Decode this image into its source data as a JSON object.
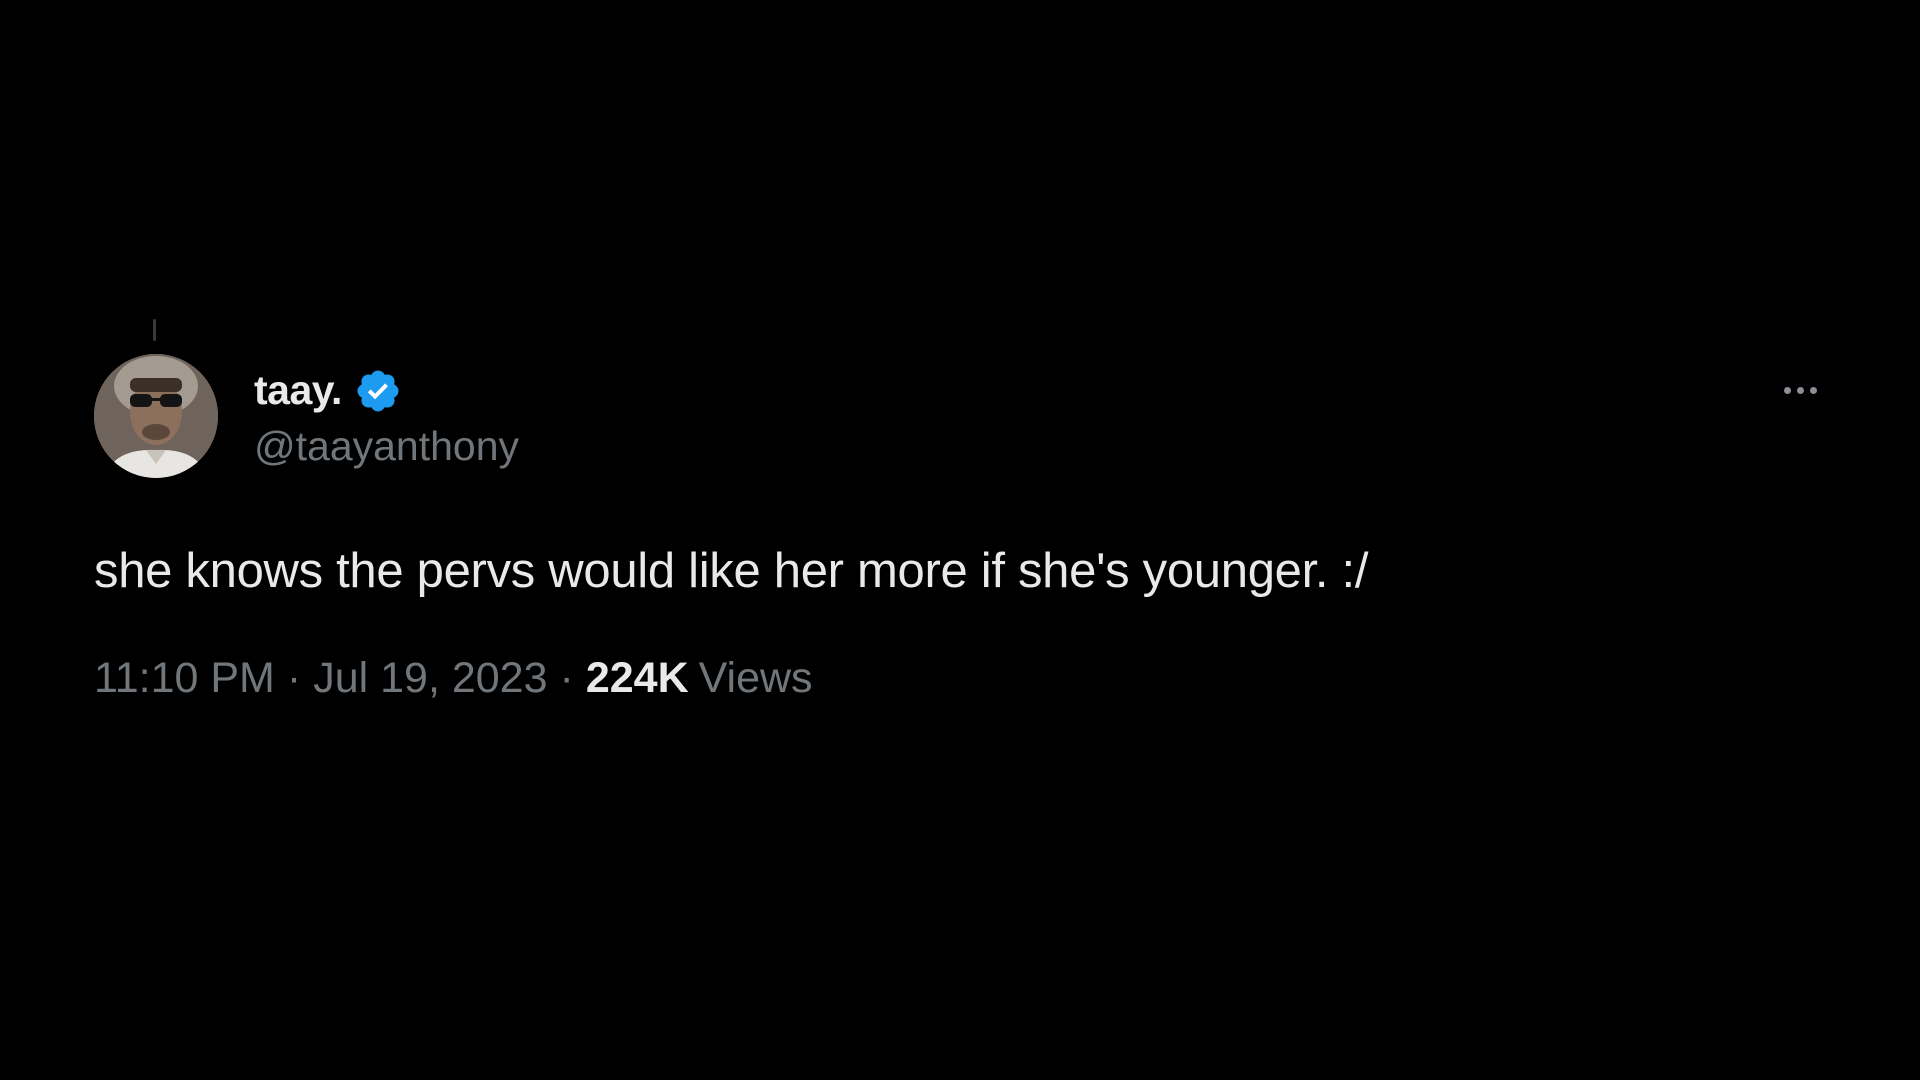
{
  "tweet": {
    "author": {
      "display_name": "taay.",
      "handle": "@taayanthony",
      "verified": true,
      "verified_icon": "verified-badge-icon",
      "avatar_icon": "user-avatar"
    },
    "text": "she knows the pervs would like her more if she's younger. :/",
    "time": "11:10 PM",
    "separator": "·",
    "date": "Jul 19, 2023",
    "views_count": "224K",
    "views_label": "Views"
  },
  "colors": {
    "background": "#000000",
    "primary_text": "#e7e9ea",
    "secondary_text": "#71767b",
    "verified_blue": "#1d9bf0"
  }
}
